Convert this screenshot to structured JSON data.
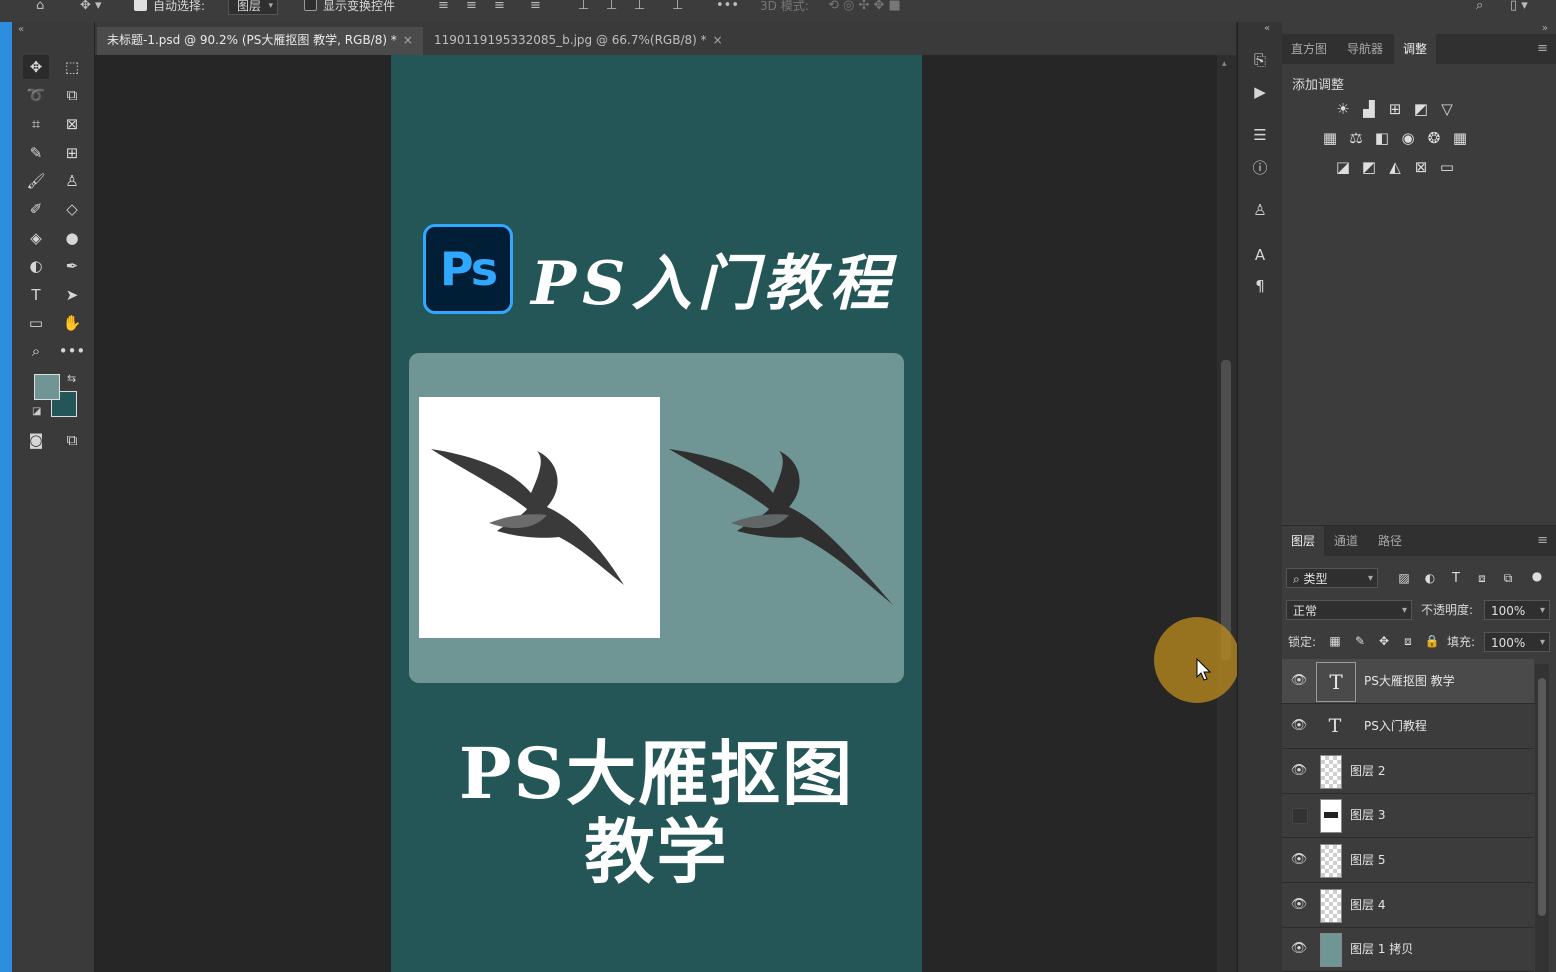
{
  "optionsbar": {
    "auto_select_label": "自动选择:",
    "auto_select_target": "图层",
    "show_transform_label": "显示变换控件",
    "mode3d_label": "3D 模式:"
  },
  "tabs": [
    {
      "label": "未标题-1.psd @ 90.2% (PS大雁抠图 教学, RGB/8) *",
      "close": "×"
    },
    {
      "label": "1190119195332085_b.jpg @ 66.7%(RGB/8) *",
      "close": "×"
    }
  ],
  "document": {
    "logo_text": "Ps",
    "headline": "PS入门教程",
    "title_line1": "PS大雁抠图",
    "title_line2": "教学"
  },
  "adjust_panel": {
    "tabs": [
      "直方图",
      "导航器",
      "调整"
    ],
    "active_tab": "调整",
    "add_label": "添加调整"
  },
  "layers_panel": {
    "tabs": [
      "图层",
      "通道",
      "路径"
    ],
    "active_tab": "图层",
    "filter_label": "类型",
    "blend_mode": "正常",
    "opacity_label": "不透明度:",
    "opacity_value": "100%",
    "lock_label": "锁定:",
    "fill_label": "填充:",
    "fill_value": "100%",
    "layers": [
      {
        "name": "PS大雁抠图 教学",
        "type": "text",
        "visible": true,
        "selected": true
      },
      {
        "name": "PS入门教程",
        "type": "text",
        "visible": true,
        "selected": false
      },
      {
        "name": "图层 2",
        "type": "pixel",
        "visible": true,
        "selected": false
      },
      {
        "name": "图层 3",
        "type": "pixel",
        "visible": false,
        "selected": false
      },
      {
        "name": "图层 5",
        "type": "pixel",
        "visible": true,
        "selected": false
      },
      {
        "name": "图层 4",
        "type": "pixel",
        "visible": true,
        "selected": false
      },
      {
        "name": "图层 1 拷贝",
        "type": "pixel",
        "visible": true,
        "selected": false
      }
    ]
  },
  "colors": {
    "foreground": "#6f9594",
    "background": "#245658",
    "doc_bg": "#245658",
    "card_bg": "#6f9594",
    "accent": "#31a8ff"
  }
}
